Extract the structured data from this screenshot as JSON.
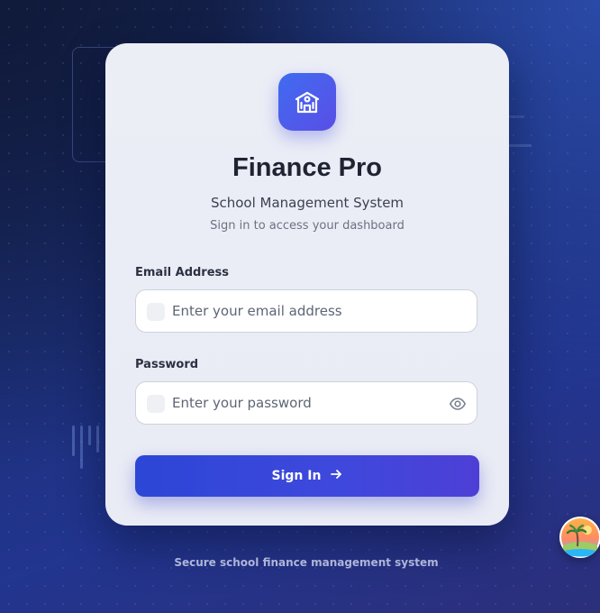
{
  "app": {
    "title": "Finance Pro",
    "subtitle": "School Management System",
    "tagline": "Sign in to access your dashboard"
  },
  "form": {
    "email_label": "Email Address",
    "email_placeholder": "Enter your email address",
    "email_value": "",
    "password_label": "Password",
    "password_placeholder": "Enter your password",
    "password_value": "",
    "submit_label": "Sign In"
  },
  "footer": {
    "text": "Secure school finance management system"
  },
  "icons": {
    "logo": "school-building-icon",
    "email": "mail-icon",
    "password": "lock-icon",
    "toggle_password": "eye-icon",
    "submit": "arrow-right-icon",
    "badge": "palm-tree-island-icon"
  },
  "colors": {
    "accent": "#3f48dc",
    "logo_gradient_start": "#3f6cf0",
    "logo_gradient_end": "#5a4ee6",
    "card_background": "#eceef6",
    "title": "#1f2433"
  }
}
